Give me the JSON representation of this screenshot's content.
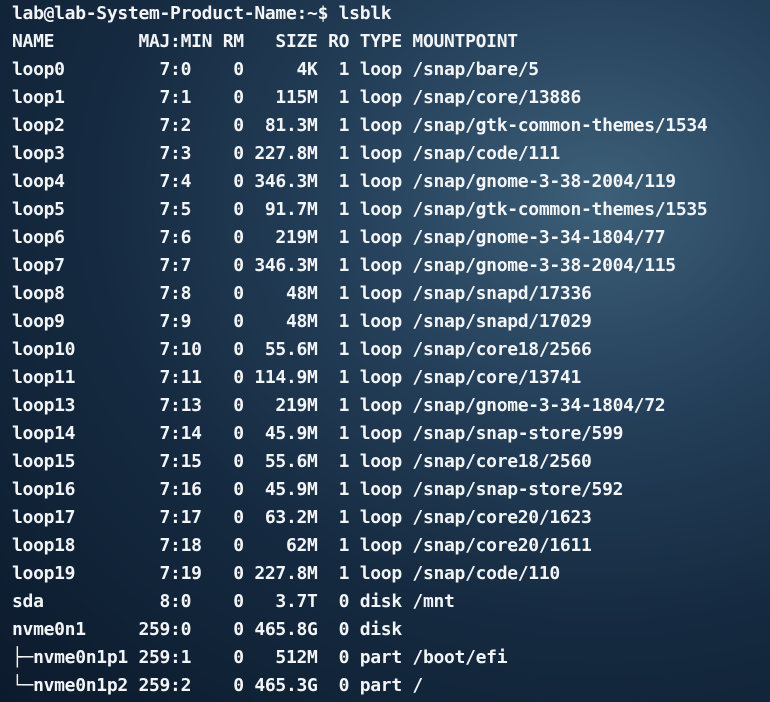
{
  "terminal": {
    "prompt": "lab@lab-System-Product-Name:~$ lsblk",
    "header": "NAME        MAJ:MIN RM   SIZE RO TYPE MOUNTPOINT",
    "rows": [
      "loop0         7:0    0     4K  1 loop /snap/bare/5",
      "loop1         7:1    0   115M  1 loop /snap/core/13886",
      "loop2         7:2    0  81.3M  1 loop /snap/gtk-common-themes/1534",
      "loop3         7:3    0 227.8M  1 loop /snap/code/111",
      "loop4         7:4    0 346.3M  1 loop /snap/gnome-3-38-2004/119",
      "loop5         7:5    0  91.7M  1 loop /snap/gtk-common-themes/1535",
      "loop6         7:6    0   219M  1 loop /snap/gnome-3-34-1804/77",
      "loop7         7:7    0 346.3M  1 loop /snap/gnome-3-38-2004/115",
      "loop8         7:8    0    48M  1 loop /snap/snapd/17336",
      "loop9         7:9    0    48M  1 loop /snap/snapd/17029",
      "loop10        7:10   0  55.6M  1 loop /snap/core18/2566",
      "loop11        7:11   0 114.9M  1 loop /snap/core/13741",
      "loop13        7:13   0   219M  1 loop /snap/gnome-3-34-1804/72",
      "loop14        7:14   0  45.9M  1 loop /snap/snap-store/599",
      "loop15        7:15   0  55.6M  1 loop /snap/core18/2560",
      "loop16        7:16   0  45.9M  1 loop /snap/snap-store/592",
      "loop17        7:17   0  63.2M  1 loop /snap/core20/1623",
      "loop18        7:18   0    62M  1 loop /snap/core20/1611",
      "loop19        7:19   0 227.8M  1 loop /snap/code/110",
      "sda           8:0    0   3.7T  0 disk /mnt",
      "nvme0n1     259:0    0 465.8G  0 disk",
      "├─nvme0n1p1 259:1    0   512M  0 part /boot/efi",
      "└─nvme0n1p2 259:2    0 465.3G  0 part /"
    ]
  }
}
